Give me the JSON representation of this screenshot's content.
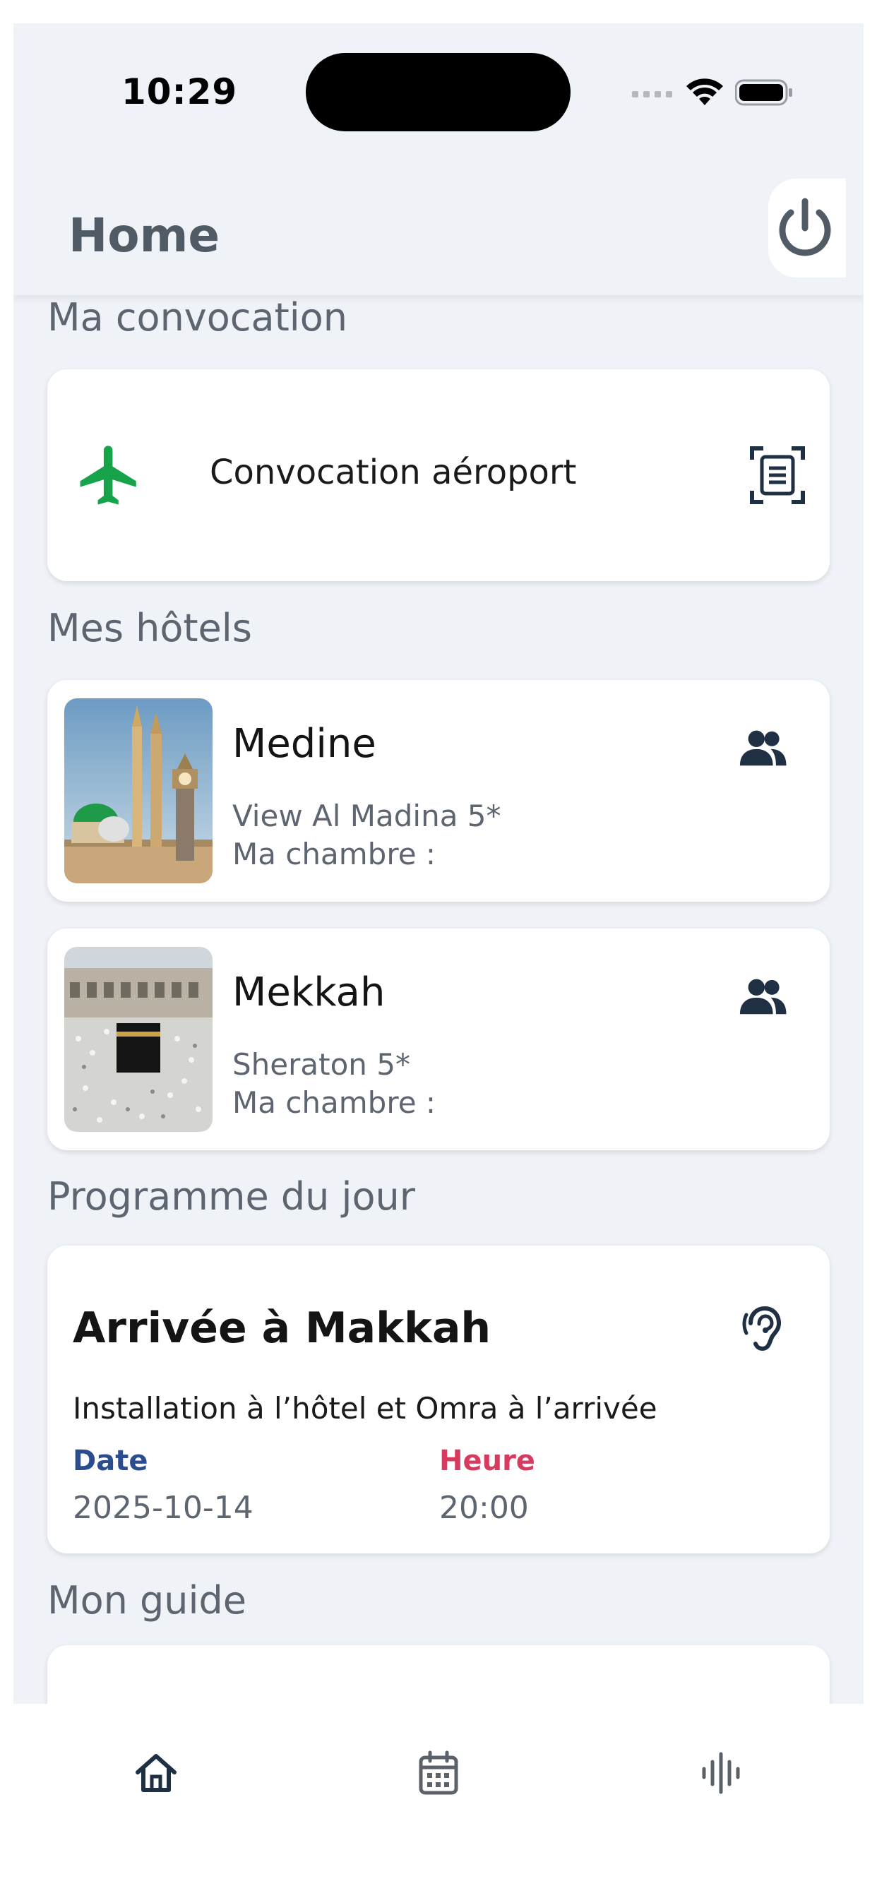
{
  "status_bar": {
    "time": "10:29"
  },
  "header": {
    "title": "Home",
    "power_icon": "power-icon"
  },
  "convocation": {
    "section_title": "Ma convocation",
    "label": "Convocation aéroport",
    "plane_color": "#16a34a"
  },
  "hotels": {
    "section_title": "Mes hôtels",
    "items": [
      {
        "city": "Medine",
        "hotel": "View Al Madina 5*",
        "room_label": "Ma chambre :"
      },
      {
        "city": "Mekkah",
        "hotel": "Sheraton 5*",
        "room_label": "Ma chambre :"
      }
    ]
  },
  "programme": {
    "section_title": "Programme du jour",
    "title": "Arrivée à Makkah",
    "description": "Installation à l’hôtel et Omra à l’arrivée",
    "date_label": "Date",
    "date_value": "2025-10-14",
    "time_label": "Heure",
    "time_value": "20:00"
  },
  "guide": {
    "section_title": "Mon guide"
  },
  "tabbar": {
    "items": [
      "home-icon",
      "calendar-icon",
      "audio-icon"
    ]
  }
}
